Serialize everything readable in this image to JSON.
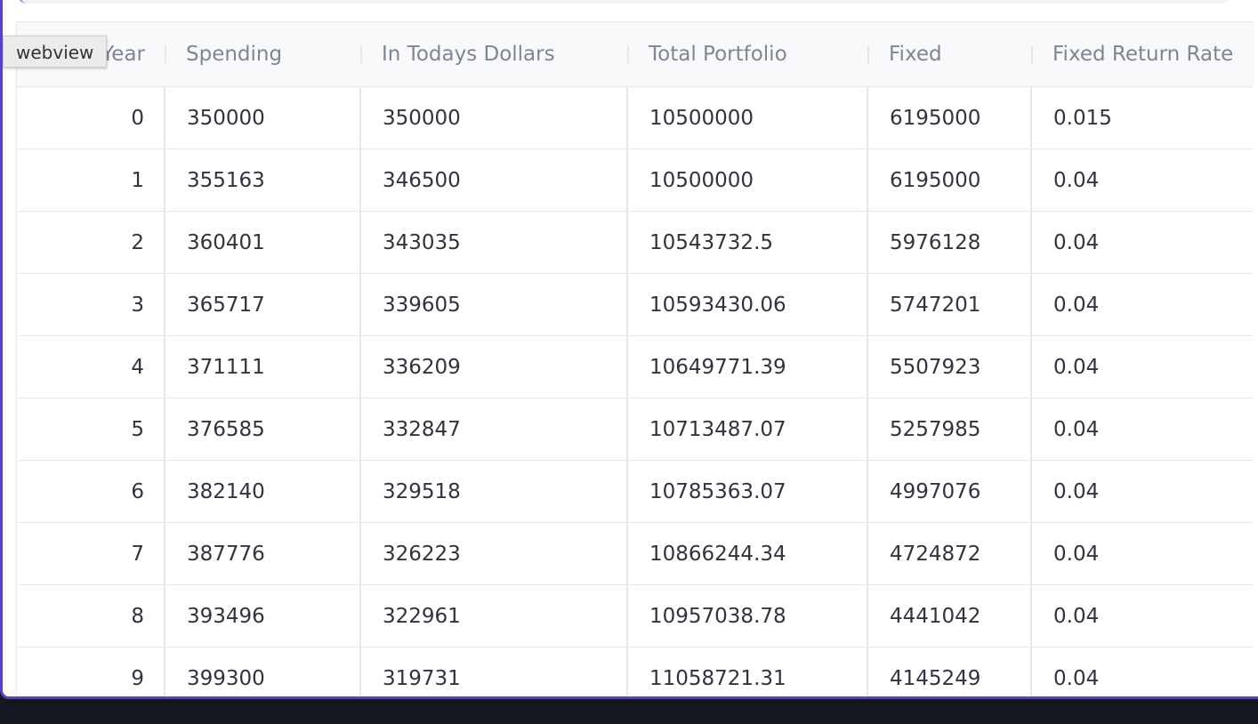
{
  "tooltip": {
    "text": "webview"
  },
  "table": {
    "columns": [
      "Year",
      "Spending",
      "In Todays Dollars",
      "Total Portfolio",
      "Fixed",
      "Fixed Return Rate"
    ],
    "rows": [
      [
        "0",
        "350000",
        "350000",
        "10500000",
        "6195000",
        "0.015"
      ],
      [
        "1",
        "355163",
        "346500",
        "10500000",
        "6195000",
        "0.04"
      ],
      [
        "2",
        "360401",
        "343035",
        "10543732.5",
        "5976128",
        "0.04"
      ],
      [
        "3",
        "365717",
        "339605",
        "10593430.06",
        "5747201",
        "0.04"
      ],
      [
        "4",
        "371111",
        "336209",
        "10649771.39",
        "5507923",
        "0.04"
      ],
      [
        "5",
        "376585",
        "332847",
        "10713487.07",
        "5257985",
        "0.04"
      ],
      [
        "6",
        "382140",
        "329518",
        "10785363.07",
        "4997076",
        "0.04"
      ],
      [
        "7",
        "387776",
        "326223",
        "10866244.34",
        "4724872",
        "0.04"
      ],
      [
        "8",
        "393496",
        "322961",
        "10957038.78",
        "4441042",
        "0.04"
      ],
      [
        "9",
        "399300",
        "319731",
        "11058721.31",
        "4145249",
        "0.04"
      ]
    ]
  },
  "colors": {
    "frame_accent": "#5b3fc4",
    "header_bg": "#f8f9fb",
    "header_text": "#808495",
    "cell_text": "#31333f",
    "grid_line": "#e6e8ec",
    "taskbar": "#141622"
  }
}
